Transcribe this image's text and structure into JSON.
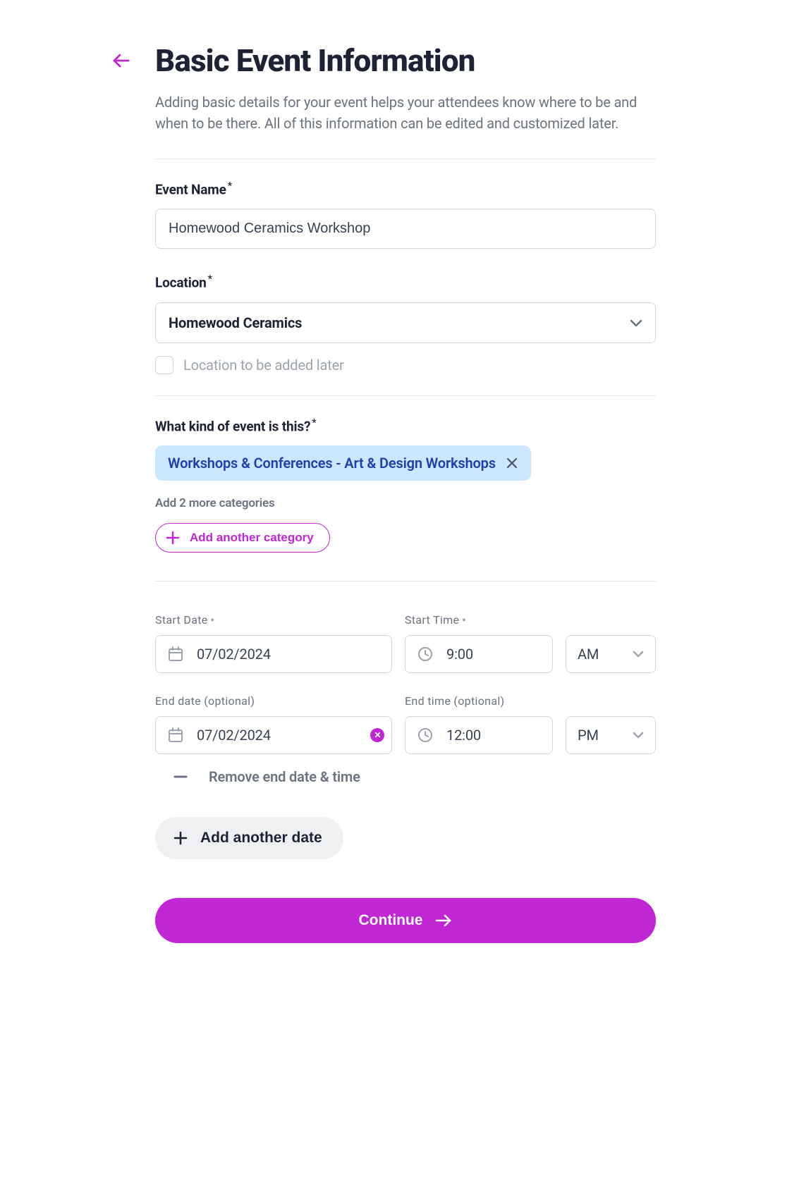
{
  "header": {
    "title": "Basic Event Information",
    "subtitle": "Adding basic details for your event helps your attendees know where to be and when to be there. All of this information can be edited and customized later."
  },
  "fields": {
    "event_name": {
      "label": "Event Name",
      "value": "Homewood Ceramics Workshop"
    },
    "location": {
      "label": "Location",
      "selected": "Homewood Ceramics",
      "later_label": "Location to be added later"
    },
    "category": {
      "label": "What kind of event is this?",
      "chip": "Workshops & Conferences - Art & Design Workshops",
      "hint": "Add 2 more categories",
      "add_label": "Add another category"
    },
    "start_date": {
      "label": "Start Date",
      "value": "07/02/2024"
    },
    "start_time": {
      "label": "Start Time",
      "value": "9:00",
      "ampm": "AM"
    },
    "end_date": {
      "label": "End date (optional)",
      "value": "07/02/2024"
    },
    "end_time": {
      "label": "End time (optional)",
      "value": "12:00",
      "ampm": "PM"
    },
    "remove_label": "Remove end date & time",
    "add_date_label": "Add another date"
  },
  "actions": {
    "continue": "Continue"
  }
}
